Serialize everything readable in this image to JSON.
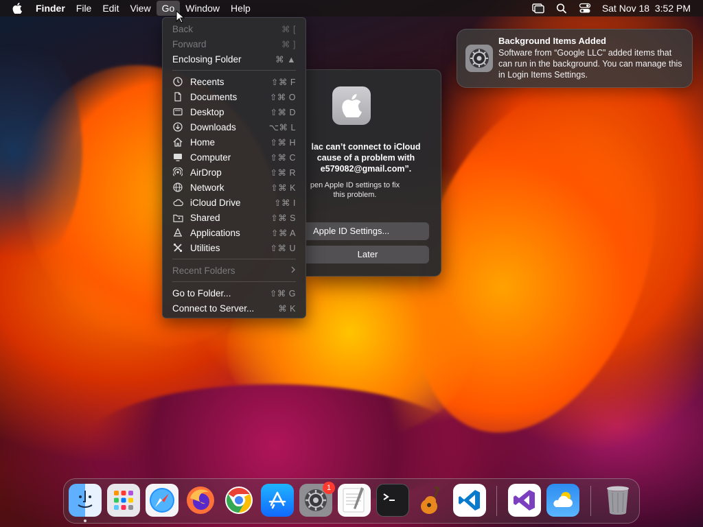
{
  "menubar": {
    "app_name": "Finder",
    "items": [
      "File",
      "Edit",
      "View",
      "Go",
      "Window",
      "Help"
    ],
    "active_item": "Go",
    "clock": "Sat Nov 18  3:52 PM",
    "status_icons": [
      "screen-mirroring-icon",
      "spotlight-icon",
      "control-center-icon"
    ]
  },
  "go_menu": {
    "nav": [
      {
        "label": "Back",
        "shortcut": "⌘ [",
        "enabled": false
      },
      {
        "label": "Forward",
        "shortcut": "⌘ ]",
        "enabled": false
      },
      {
        "label": "Enclosing Folder",
        "shortcut": "⌘ ▲",
        "enabled": true
      }
    ],
    "places": [
      {
        "label": "Recents",
        "shortcut": "⇧⌘ F",
        "icon": "clock-icon"
      },
      {
        "label": "Documents",
        "shortcut": "⇧⌘ O",
        "icon": "document-icon"
      },
      {
        "label": "Desktop",
        "shortcut": "⇧⌘ D",
        "icon": "desktop-icon"
      },
      {
        "label": "Downloads",
        "shortcut": "⌥⌘ L",
        "icon": "download-icon"
      },
      {
        "label": "Home",
        "shortcut": "⇧⌘ H",
        "icon": "home-icon"
      },
      {
        "label": "Computer",
        "shortcut": "⇧⌘ C",
        "icon": "computer-icon"
      },
      {
        "label": "AirDrop",
        "shortcut": "⇧⌘ R",
        "icon": "airdrop-icon"
      },
      {
        "label": "Network",
        "shortcut": "⇧⌘ K",
        "icon": "network-icon"
      },
      {
        "label": "iCloud Drive",
        "shortcut": "⇧⌘ I",
        "icon": "cloud-icon"
      },
      {
        "label": "Shared",
        "shortcut": "⇧⌘ S",
        "icon": "shared-folder-icon"
      },
      {
        "label": "Applications",
        "shortcut": "⇧⌘ A",
        "icon": "applications-icon"
      },
      {
        "label": "Utilities",
        "shortcut": "⇧⌘ U",
        "icon": "utilities-icon"
      }
    ],
    "recent_folders": {
      "label": "Recent Folders",
      "enabled": false
    },
    "goto_folder": {
      "label": "Go to Folder...",
      "shortcut": "⇧⌘ G"
    },
    "connect_server": {
      "label": "Connect to Server...",
      "shortcut": "⌘ K"
    }
  },
  "dialog": {
    "title": "lac can’t connect to iCloud\ncause of a problem with\ne579082@gmail.com”.",
    "message": "pen Apple ID settings to fix\nthis problem.",
    "primary_button": "Apple ID Settings...",
    "secondary_button": "Later"
  },
  "notification": {
    "title": "Background Items Added",
    "body": "Software from “Google LLC” added items that can run in the background. You can manage this in Login Items Settings."
  },
  "dock": {
    "apps": [
      "Finder",
      "Launchpad",
      "Safari",
      "Firefox",
      "Google Chrome",
      "App Store",
      "System Settings",
      "TextEdit",
      "Terminal",
      "GarageBand",
      "Visual Studio Code",
      "Visual Studio",
      "Weather",
      "Trash"
    ],
    "system_settings_badge": "1"
  }
}
